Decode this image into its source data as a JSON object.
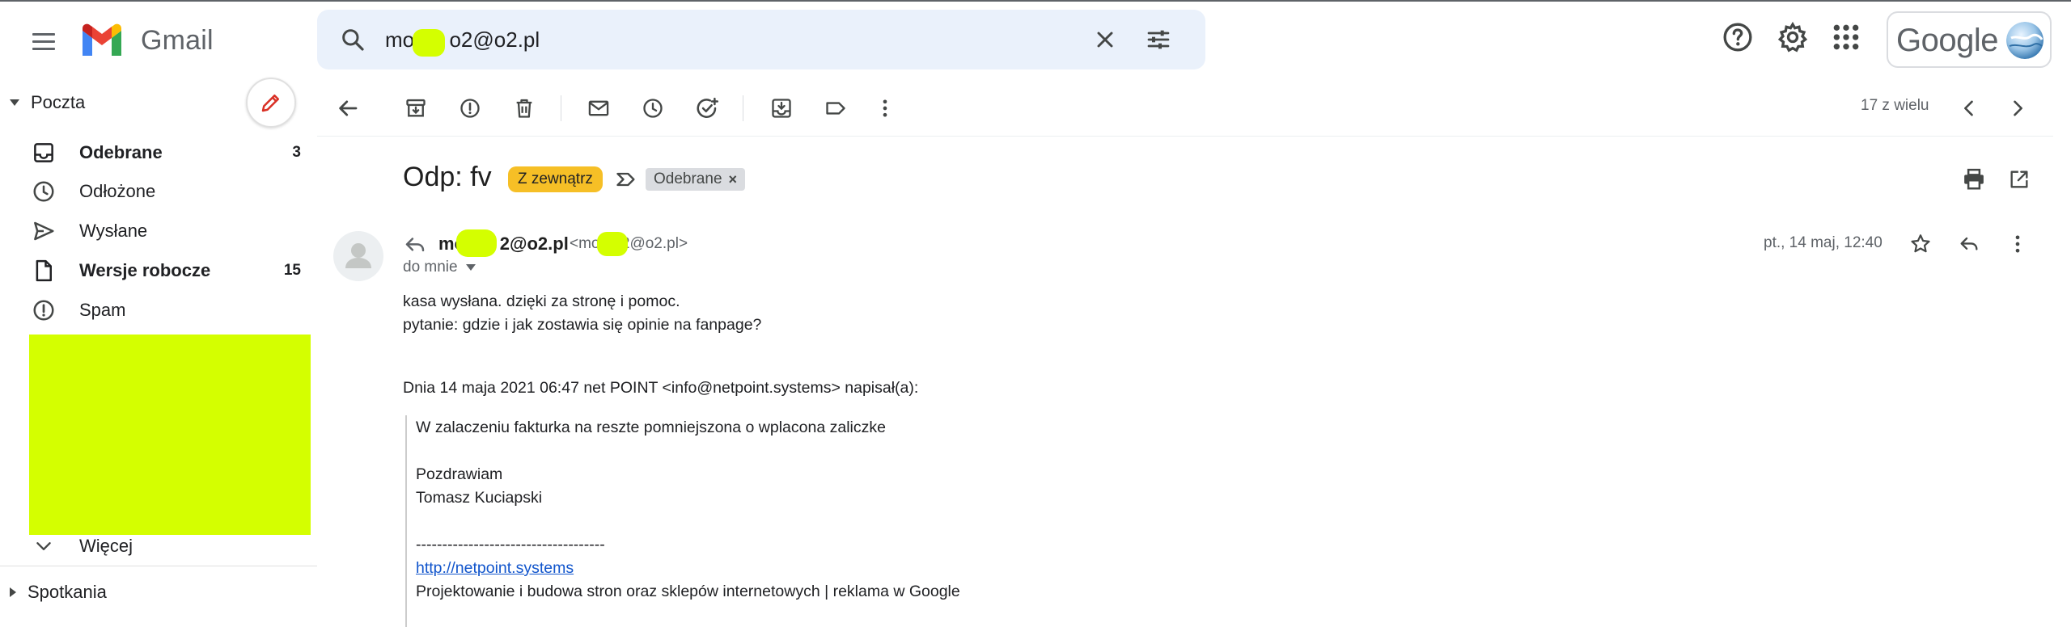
{
  "app": {
    "name": "Gmail",
    "brand_colors": {
      "red": "#ea4335",
      "blue": "#4285f4",
      "green": "#34a853",
      "yellow": "#fbbc04"
    }
  },
  "header": {
    "search": {
      "value": "mo      o2@o2.pl"
    },
    "account_badge": "Google"
  },
  "sidebar": {
    "mail_section": "Poczta",
    "items": [
      {
        "label": "Odebrane",
        "count": "3",
        "icon": "inbox-icon"
      },
      {
        "label": "Odłożone",
        "count": "",
        "icon": "clock-icon"
      },
      {
        "label": "Wysłane",
        "count": "",
        "icon": "send-icon"
      },
      {
        "label": "Wersje robocze",
        "count": "15",
        "icon": "draft-icon"
      },
      {
        "label": "Spam",
        "count": "",
        "icon": "spam-icon"
      }
    ],
    "more_label": "Więcej",
    "meetings_section": "Spotkania"
  },
  "toolbar": {
    "pager": "17 z wielu"
  },
  "message": {
    "subject": "Odp: fv",
    "labels": {
      "external": "Z zewnątrz",
      "inbox": "Odebrane",
      "remove": "×"
    },
    "sender_name": "mo       2@o2.pl",
    "sender_email": "<mo     2@o2.pl>",
    "recipient": "do mnie",
    "date": "pt., 14 maj, 12:40",
    "body": [
      "kasa wysłana. dzięki za stronę i pomoc.",
      "pytanie: gdzie i jak zostawia się opinie na fanpage?"
    ],
    "quote_header": "Dnia 14 maja 2021 06:47 net POINT <info@netpoint.systems> napisał(a):",
    "quoted": {
      "line1": "W zalaczeniu fakturka na reszte pomniejszona o wplacona zaliczke",
      "greeting": "Pozdrawiam",
      "signature": "Tomasz Kuciapski",
      "separator": "------------------------------------",
      "link": "http://netpoint.systems",
      "tagline": "Projektowanie i budowa stron oraz sklepów internetowych | reklama w Google"
    }
  }
}
